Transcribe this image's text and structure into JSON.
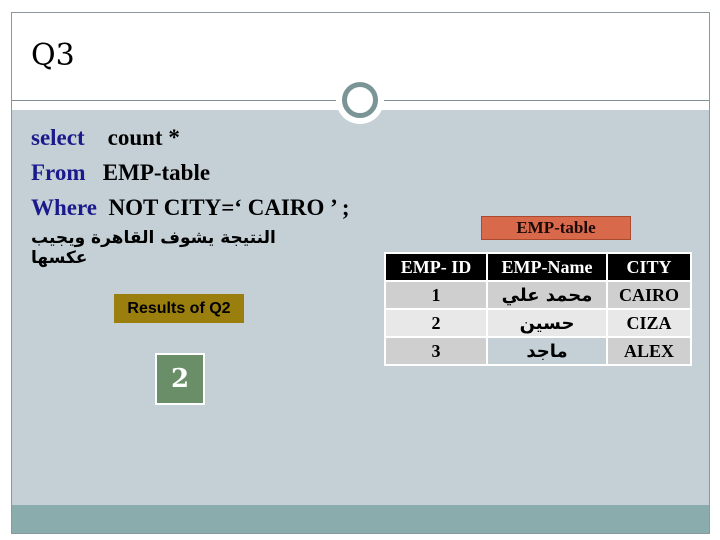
{
  "slide": {
    "title": "Q3",
    "sql": {
      "line1": {
        "keyword": "select",
        "rest": "count *"
      },
      "line2": {
        "keyword": "From",
        "rest": "EMP-table"
      },
      "line3": {
        "keyword": "Where",
        "rest": "NOT CITY=‘ CAIRO ’ ;"
      }
    },
    "note_arabic": "النتيجة يشوف القاهرة ويجيب عكسها",
    "results_label": "Results of Q2",
    "result_value": "2",
    "table_label": "EMP-table",
    "table": {
      "headers": [
        "EMP- ID",
        "EMP-Name",
        "CITY"
      ],
      "rows": [
        {
          "id": "1",
          "name": "محمد علي",
          "city": "CAIRO"
        },
        {
          "id": "2",
          "name": "حسين",
          "city": "CIZA"
        },
        {
          "id": "3",
          "name": "ماجد",
          "city": "ALEX"
        }
      ]
    },
    "colors": {
      "content_bg": "#c4d0d6",
      "footer_band": "#8aacad",
      "keyword": "#1a1a8c",
      "results_label_bg": "#9a7e0e",
      "result_box_bg": "#6a8f68",
      "table_label_bg": "#d9694b",
      "header_bg": "#000000"
    }
  }
}
